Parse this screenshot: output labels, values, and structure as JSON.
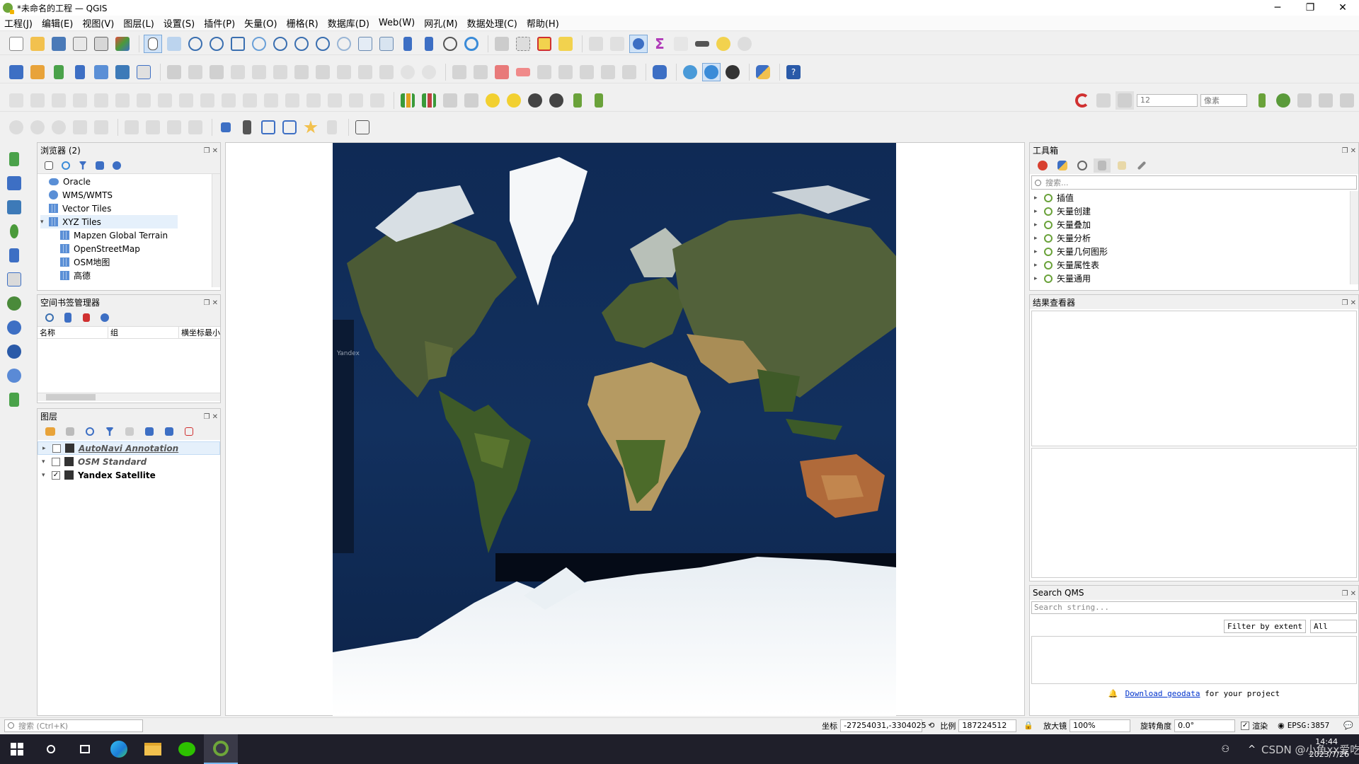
{
  "window": {
    "title": "*未命名的工程 — QGIS",
    "minimize": "─",
    "maximize": "❐",
    "close": "✕"
  },
  "menu": [
    "工程(J)",
    "编辑(E)",
    "视图(V)",
    "图层(L)",
    "设置(S)",
    "插件(P)",
    "矢量(O)",
    "栅格(R)",
    "数据库(D)",
    "Web(W)",
    "网孔(M)",
    "数据处理(C)",
    "帮助(H)"
  ],
  "toolbar": {
    "snap_tolerance": "12",
    "snap_unit": "像素"
  },
  "browser": {
    "title": "浏览器 (2)",
    "items": [
      {
        "label": "Oracle",
        "icon": "database-icon",
        "indent": 0,
        "arrow": ""
      },
      {
        "label": "WMS/WMTS",
        "icon": "globe-icon",
        "indent": 0,
        "arrow": ""
      },
      {
        "label": "Vector Tiles",
        "icon": "grid-icon",
        "indent": 0,
        "arrow": ""
      },
      {
        "label": "XYZ Tiles",
        "icon": "grid-icon",
        "indent": 0,
        "arrow": "▾"
      },
      {
        "label": "Mapzen Global Terrain",
        "icon": "grid-icon",
        "indent": 1,
        "arrow": ""
      },
      {
        "label": "OpenStreetMap",
        "icon": "grid-icon",
        "indent": 1,
        "arrow": ""
      },
      {
        "label": "OSM地图",
        "icon": "grid-icon",
        "indent": 1,
        "arrow": ""
      },
      {
        "label": "高德",
        "icon": "grid-icon",
        "indent": 1,
        "arrow": ""
      }
    ]
  },
  "bookmarks": {
    "title": "空间书签管理器",
    "columns": [
      "名称",
      "组",
      "横坐标最小"
    ]
  },
  "layers": {
    "title": "图层",
    "items": [
      {
        "label": "AutoNavi Annotation",
        "checked": false,
        "arrow": "▸",
        "style": "italic-gray-underline"
      },
      {
        "label": "OSM Standard",
        "checked": false,
        "arrow": "▾",
        "style": "italic-gray"
      },
      {
        "label": "Yandex Satellite",
        "checked": true,
        "arrow": "▾",
        "style": "bold"
      }
    ]
  },
  "toolbox": {
    "title": "工具箱",
    "search_placeholder": "搜索...",
    "items": [
      "插值",
      "矢量创建",
      "矢量叠加",
      "矢量分析",
      "矢量几何图形",
      "矢量属性表",
      "矢量通用"
    ]
  },
  "results": {
    "title": "结果查看器"
  },
  "qms": {
    "title": "Search QMS",
    "search_placeholder": "Search string...",
    "filter_label": "Filter by extent",
    "filter_value": "All",
    "download_link": "Download geodata",
    "download_suffix": " for your project"
  },
  "map": {
    "watermark": "Yandex"
  },
  "status": {
    "search_placeholder": "搜索 (Ctrl+K)",
    "coord_label": "坐标",
    "coord_value": "-27254031,-3304025",
    "scale_label": "比例",
    "scale_value": "187224512",
    "magnifier_label": "放大镜",
    "magnifier_value": "100%",
    "rotation_label": "旋转角度",
    "rotation_value": "0.0°",
    "render_label": "渲染",
    "crs": "EPSG:3857"
  },
  "taskbar": {
    "time": "14:44",
    "date": "2023/7/26",
    "watermark": "CSDN @小鱼xx爱吃鱼"
  }
}
